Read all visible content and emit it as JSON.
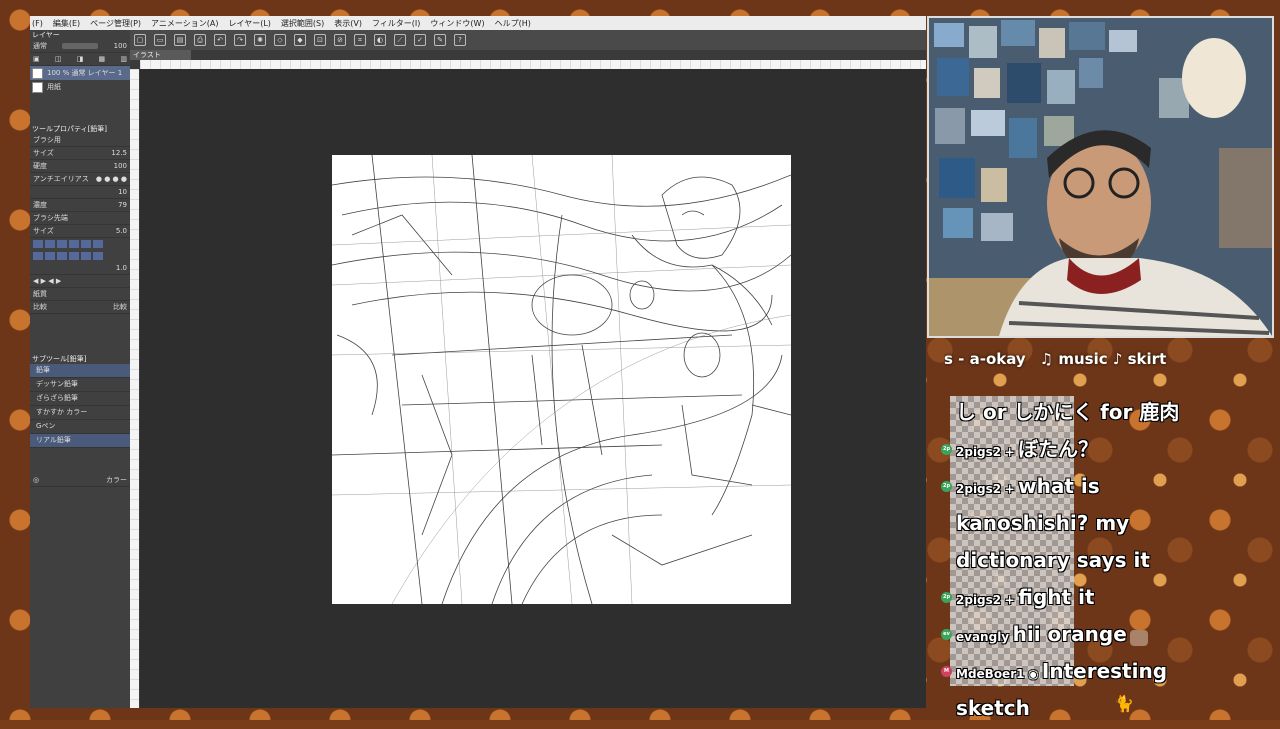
{
  "menu": [
    "(F)",
    "編集(E)",
    "ページ管理(P)",
    "アニメーション(A)",
    "レイヤー(L)",
    "選択範囲(S)",
    "表示(V)",
    "フィルター(I)",
    "ウィンドウ(W)",
    "ヘルプ(H)"
  ],
  "canvas_tab": "イラスト",
  "layers_panel": {
    "header": "レイヤー",
    "blend_mode": "通常",
    "opacity": "100",
    "layers": [
      {
        "name": "100 % 通常\nレイヤー 1",
        "active": true
      },
      {
        "name": "用紙",
        "active": false
      }
    ]
  },
  "tool_property": {
    "header": "ツールプロパティ[鉛筆]",
    "tool_name": "ブラシ用",
    "rows": [
      {
        "label": "サイズ",
        "value": "12.5"
      },
      {
        "label": "硬度",
        "value": "100"
      },
      {
        "label": "アンチエイリアス",
        "value": ""
      },
      {
        "label": "",
        "value": "10"
      },
      {
        "label": "濃度",
        "value": "79"
      },
      {
        "label": "ブラシ先端",
        "value": ""
      },
      {
        "label": "サイズ",
        "value": "5.0"
      },
      {
        "label": "",
        "value": "1.0"
      }
    ],
    "paper_label": "紙質",
    "merge_label": "比較",
    "merge_mode": "比較"
  },
  "subtool": {
    "header": "サブツール[鉛筆]",
    "active_tab": "鉛筆",
    "items": [
      "デッサン鉛筆",
      "ざらざら鉛筆",
      "すかすか カラー",
      "Gペン",
      "リアル鉛筆"
    ]
  },
  "color_panel_label": "カラー",
  "ticker": {
    "items": [
      "s - a-okay",
      "♫ music ♪ skirt"
    ]
  },
  "chat": [
    {
      "user": "",
      "message": "し or しかにく for 鹿肉",
      "badge": ""
    },
    {
      "user": "2pigs2",
      "message": "ぼたん？",
      "badge": "2p"
    },
    {
      "user": "2pigs2",
      "message": "what is",
      "badge": "2p"
    },
    {
      "user": "",
      "message": "kanoshishi? my",
      "badge": ""
    },
    {
      "user": "",
      "message": "dictionary says it",
      "badge": ""
    },
    {
      "user": "2pigs2",
      "message": "fight it",
      "badge": "2p"
    },
    {
      "user": "evangly",
      "message": "hii orange",
      "badge": "ev"
    },
    {
      "user": "MdeBoer1",
      "message": "Interesting",
      "badge": "M"
    },
    {
      "user": "",
      "message": "sketch",
      "badge": ""
    }
  ],
  "colors": {
    "accent": "#5a6a8a",
    "chat_badge": "#3aa55d",
    "mod_badge": "#d04060"
  }
}
